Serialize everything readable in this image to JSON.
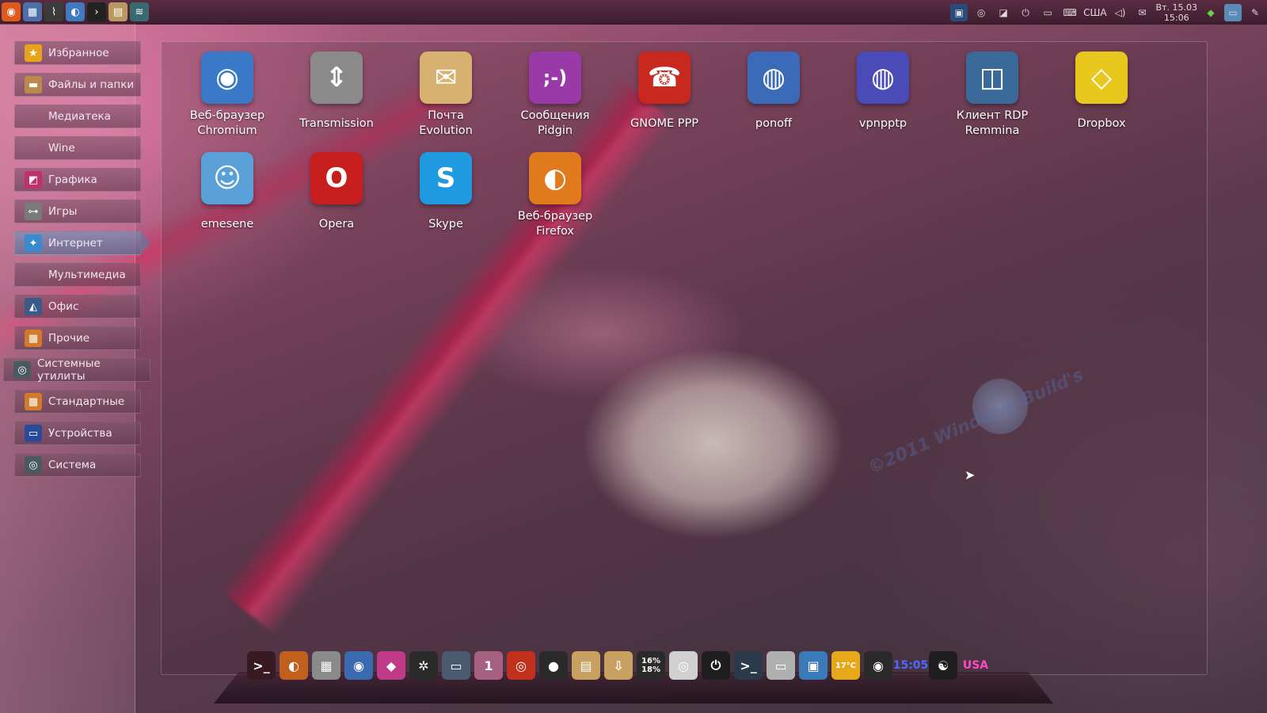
{
  "top_panel": {
    "launchers": [
      {
        "icon": "ubuntu-logo-icon",
        "glyph": "◉",
        "color": "#e05a1c"
      },
      {
        "icon": "places-icon",
        "glyph": "▦",
        "color": "#4b6fa8"
      },
      {
        "icon": "system-monitor-icon",
        "glyph": "⌇",
        "color": "#3b3b3b"
      },
      {
        "icon": "browser-icon",
        "glyph": "◐",
        "color": "#3d7ac0"
      },
      {
        "icon": "terminal-icon",
        "glyph": "›",
        "color": "#222222"
      },
      {
        "icon": "file-manager-icon",
        "glyph": "▤",
        "color": "#b89a60"
      },
      {
        "icon": "network-icon",
        "glyph": "≋",
        "color": "#3a6a70"
      }
    ],
    "tray": {
      "layout_indicator": "США",
      "date_line": "Вт. 15.03",
      "time_line": "15:06"
    }
  },
  "sidebar": {
    "items": [
      {
        "label": "Избранное",
        "icon": "star-icon",
        "glyph": "★",
        "color": "#e8a31c"
      },
      {
        "label": "Файлы и папки",
        "icon": "folder-icon",
        "glyph": "▬",
        "color": "#b98a4a"
      },
      {
        "label": "Медиатека",
        "icon": "",
        "glyph": "",
        "color": ""
      },
      {
        "label": "Wine",
        "icon": "",
        "glyph": "",
        "color": ""
      },
      {
        "label": "Графика",
        "icon": "graphics-icon",
        "glyph": "◩",
        "color": "#c0306a"
      },
      {
        "label": "Игры",
        "icon": "gamepad-icon",
        "glyph": "⊶",
        "color": "#7a7a7a"
      },
      {
        "label": "Интернет",
        "icon": "internet-icon",
        "glyph": "✦",
        "color": "#3a8ad0"
      },
      {
        "label": "Мультимедиа",
        "icon": "",
        "glyph": "",
        "color": ""
      },
      {
        "label": "Офис",
        "icon": "office-icon",
        "glyph": "◭",
        "color": "#3a5a8a"
      },
      {
        "label": "Прочие",
        "icon": "other-icon",
        "glyph": "▦",
        "color": "#d07a2a"
      },
      {
        "label": "Системные утилиты",
        "icon": "system-tools-icon",
        "glyph": "◎",
        "color": "#4a5a60"
      },
      {
        "label": "Стандартные",
        "icon": "accessories-icon",
        "glyph": "▦",
        "color": "#d07a2a"
      },
      {
        "label": "Устройства",
        "icon": "devices-icon",
        "glyph": "▭",
        "color": "#2a4a9a"
      },
      {
        "label": "Система",
        "icon": "system-icon",
        "glyph": "◎",
        "color": "#4a5a60"
      }
    ],
    "active_index": 6
  },
  "apps": [
    {
      "line1": "Веб-браузер",
      "line2": "Chromium",
      "icon": "chromium-icon",
      "glyph": "◉",
      "color": "#3a78c8"
    },
    {
      "line1": "Transmission",
      "line2": "",
      "icon": "transmission-icon",
      "glyph": "⇕",
      "color": "#8a8a8a"
    },
    {
      "line1": "Почта",
      "line2": "Evolution",
      "icon": "evolution-mail-icon",
      "glyph": "✉",
      "color": "#d8b070"
    },
    {
      "line1": "Сообщения",
      "line2": "Pidgin",
      "icon": "pidgin-icon",
      "glyph": ";-)",
      "color": "#9a3aa8"
    },
    {
      "line1": "GNOME PPP",
      "line2": "",
      "icon": "telephone-icon",
      "glyph": "☎",
      "color": "#c8281e"
    },
    {
      "line1": "ponoff",
      "line2": "",
      "icon": "network-globe-icon",
      "glyph": "◍",
      "color": "#3a6ab8"
    },
    {
      "line1": "vpnpptp",
      "line2": "",
      "icon": "vpn-globe-icon",
      "glyph": "◍",
      "color": "#4a4ab8"
    },
    {
      "line1": "Клиент RDP",
      "line2": "Remmina",
      "icon": "remmina-icon",
      "glyph": "◫",
      "color": "#3a6a9a"
    },
    {
      "line1": "Dropbox",
      "line2": "",
      "icon": "dropbox-icon",
      "glyph": "◇",
      "color": "#e8c81c"
    },
    {
      "line1": "emesene",
      "line2": "",
      "icon": "emesene-icon",
      "glyph": "☺",
      "color": "#5aa0d8"
    },
    {
      "line1": "Opera",
      "line2": "",
      "icon": "opera-icon",
      "glyph": "O",
      "color": "#c81e1e"
    },
    {
      "line1": "Skype",
      "line2": "",
      "icon": "skype-icon",
      "glyph": "S",
      "color": "#1e9ae0"
    },
    {
      "line1": "Веб-браузер",
      "line2": "Firefox",
      "icon": "firefox-icon",
      "glyph": "◐",
      "color": "#e07a1c"
    }
  ],
  "watermark": {
    "text": "©2011 Windows-Build's"
  },
  "dock": {
    "items": [
      {
        "icon": "terminal-red-icon",
        "glyph": ">_",
        "color": "#3a1a22"
      },
      {
        "icon": "firefox-dock-icon",
        "glyph": "◐",
        "color": "#c0601c"
      },
      {
        "icon": "calculator-icon",
        "glyph": "▦",
        "color": "#8a8a8a"
      },
      {
        "icon": "people-icon",
        "glyph": "◉",
        "color": "#3a6ab0"
      },
      {
        "icon": "color-wheel-icon",
        "glyph": "◆",
        "color": "#c03a8a"
      },
      {
        "icon": "aperture-icon",
        "glyph": "✲",
        "color": "#2a2a2a"
      },
      {
        "icon": "desktop-switcher-icon",
        "glyph": "▭",
        "color": "#4a5a70"
      },
      {
        "icon": "workspace-icon",
        "glyph": "1",
        "color": "#a86080"
      },
      {
        "icon": "ubuntu-dock-icon",
        "glyph": "◎",
        "color": "#c0301c"
      },
      {
        "icon": "penguin-icon",
        "glyph": "●",
        "color": "#2a2a2a"
      },
      {
        "icon": "notes-icon",
        "glyph": "▤",
        "color": "#c8a060"
      },
      {
        "icon": "download-folder-icon",
        "glyph": "⇩",
        "color": "#c8a060"
      },
      {
        "icon": "cpu-monitor-icon",
        "text1": "16%",
        "text2": "18%",
        "color": "#2a2a2a"
      },
      {
        "icon": "cd-icon",
        "glyph": "◎",
        "color": "#d0d0d0"
      },
      {
        "icon": "power-icon",
        "glyph": "⏻",
        "color": "#1e1e1e"
      },
      {
        "icon": "terminal-dock-icon",
        "glyph": ">_",
        "color": "#2a3a4a"
      },
      {
        "icon": "printer-icon",
        "glyph": "▭",
        "color": "#b0b0b0"
      },
      {
        "icon": "package-icon",
        "glyph": "▣",
        "color": "#3a7ab8"
      },
      {
        "icon": "weather-icon",
        "text1": "",
        "text2": "17°C",
        "color": "#e8a81c"
      },
      {
        "icon": "speaker-icon",
        "glyph": "◉",
        "color": "#2a2a2a"
      },
      {
        "icon": "dock-clock-icon",
        "text1": "15:05",
        "text2": "",
        "color": "#1e2a6a"
      },
      {
        "icon": "gnome-foot-icon",
        "glyph": "☯",
        "color": "#1e1e1e"
      },
      {
        "icon": "keyboard-layout-icon",
        "text1": "USA",
        "text2": "",
        "color": "#a0186a"
      }
    ]
  }
}
